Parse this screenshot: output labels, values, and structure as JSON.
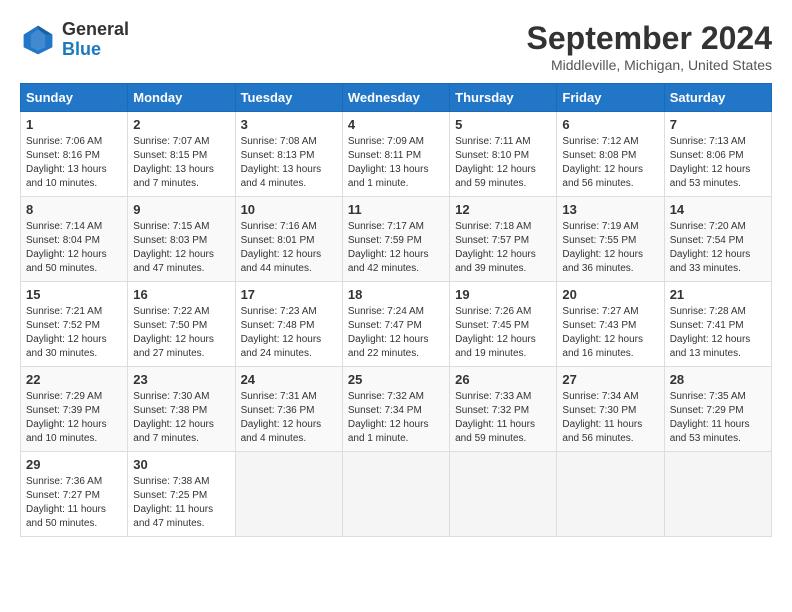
{
  "logo": {
    "line1": "General",
    "line2": "Blue"
  },
  "title": "September 2024",
  "location": "Middleville, Michigan, United States",
  "days_header": [
    "Sunday",
    "Monday",
    "Tuesday",
    "Wednesday",
    "Thursday",
    "Friday",
    "Saturday"
  ],
  "weeks": [
    [
      {
        "num": "1",
        "info": "Sunrise: 7:06 AM\nSunset: 8:16 PM\nDaylight: 13 hours\nand 10 minutes."
      },
      {
        "num": "2",
        "info": "Sunrise: 7:07 AM\nSunset: 8:15 PM\nDaylight: 13 hours\nand 7 minutes."
      },
      {
        "num": "3",
        "info": "Sunrise: 7:08 AM\nSunset: 8:13 PM\nDaylight: 13 hours\nand 4 minutes."
      },
      {
        "num": "4",
        "info": "Sunrise: 7:09 AM\nSunset: 8:11 PM\nDaylight: 13 hours\nand 1 minute."
      },
      {
        "num": "5",
        "info": "Sunrise: 7:11 AM\nSunset: 8:10 PM\nDaylight: 12 hours\nand 59 minutes."
      },
      {
        "num": "6",
        "info": "Sunrise: 7:12 AM\nSunset: 8:08 PM\nDaylight: 12 hours\nand 56 minutes."
      },
      {
        "num": "7",
        "info": "Sunrise: 7:13 AM\nSunset: 8:06 PM\nDaylight: 12 hours\nand 53 minutes."
      }
    ],
    [
      {
        "num": "8",
        "info": "Sunrise: 7:14 AM\nSunset: 8:04 PM\nDaylight: 12 hours\nand 50 minutes."
      },
      {
        "num": "9",
        "info": "Sunrise: 7:15 AM\nSunset: 8:03 PM\nDaylight: 12 hours\nand 47 minutes."
      },
      {
        "num": "10",
        "info": "Sunrise: 7:16 AM\nSunset: 8:01 PM\nDaylight: 12 hours\nand 44 minutes."
      },
      {
        "num": "11",
        "info": "Sunrise: 7:17 AM\nSunset: 7:59 PM\nDaylight: 12 hours\nand 42 minutes."
      },
      {
        "num": "12",
        "info": "Sunrise: 7:18 AM\nSunset: 7:57 PM\nDaylight: 12 hours\nand 39 minutes."
      },
      {
        "num": "13",
        "info": "Sunrise: 7:19 AM\nSunset: 7:55 PM\nDaylight: 12 hours\nand 36 minutes."
      },
      {
        "num": "14",
        "info": "Sunrise: 7:20 AM\nSunset: 7:54 PM\nDaylight: 12 hours\nand 33 minutes."
      }
    ],
    [
      {
        "num": "15",
        "info": "Sunrise: 7:21 AM\nSunset: 7:52 PM\nDaylight: 12 hours\nand 30 minutes."
      },
      {
        "num": "16",
        "info": "Sunrise: 7:22 AM\nSunset: 7:50 PM\nDaylight: 12 hours\nand 27 minutes."
      },
      {
        "num": "17",
        "info": "Sunrise: 7:23 AM\nSunset: 7:48 PM\nDaylight: 12 hours\nand 24 minutes."
      },
      {
        "num": "18",
        "info": "Sunrise: 7:24 AM\nSunset: 7:47 PM\nDaylight: 12 hours\nand 22 minutes."
      },
      {
        "num": "19",
        "info": "Sunrise: 7:26 AM\nSunset: 7:45 PM\nDaylight: 12 hours\nand 19 minutes."
      },
      {
        "num": "20",
        "info": "Sunrise: 7:27 AM\nSunset: 7:43 PM\nDaylight: 12 hours\nand 16 minutes."
      },
      {
        "num": "21",
        "info": "Sunrise: 7:28 AM\nSunset: 7:41 PM\nDaylight: 12 hours\nand 13 minutes."
      }
    ],
    [
      {
        "num": "22",
        "info": "Sunrise: 7:29 AM\nSunset: 7:39 PM\nDaylight: 12 hours\nand 10 minutes."
      },
      {
        "num": "23",
        "info": "Sunrise: 7:30 AM\nSunset: 7:38 PM\nDaylight: 12 hours\nand 7 minutes."
      },
      {
        "num": "24",
        "info": "Sunrise: 7:31 AM\nSunset: 7:36 PM\nDaylight: 12 hours\nand 4 minutes."
      },
      {
        "num": "25",
        "info": "Sunrise: 7:32 AM\nSunset: 7:34 PM\nDaylight: 12 hours\nand 1 minute."
      },
      {
        "num": "26",
        "info": "Sunrise: 7:33 AM\nSunset: 7:32 PM\nDaylight: 11 hours\nand 59 minutes."
      },
      {
        "num": "27",
        "info": "Sunrise: 7:34 AM\nSunset: 7:30 PM\nDaylight: 11 hours\nand 56 minutes."
      },
      {
        "num": "28",
        "info": "Sunrise: 7:35 AM\nSunset: 7:29 PM\nDaylight: 11 hours\nand 53 minutes."
      }
    ],
    [
      {
        "num": "29",
        "info": "Sunrise: 7:36 AM\nSunset: 7:27 PM\nDaylight: 11 hours\nand 50 minutes."
      },
      {
        "num": "30",
        "info": "Sunrise: 7:38 AM\nSunset: 7:25 PM\nDaylight: 11 hours\nand 47 minutes."
      },
      null,
      null,
      null,
      null,
      null
    ]
  ]
}
